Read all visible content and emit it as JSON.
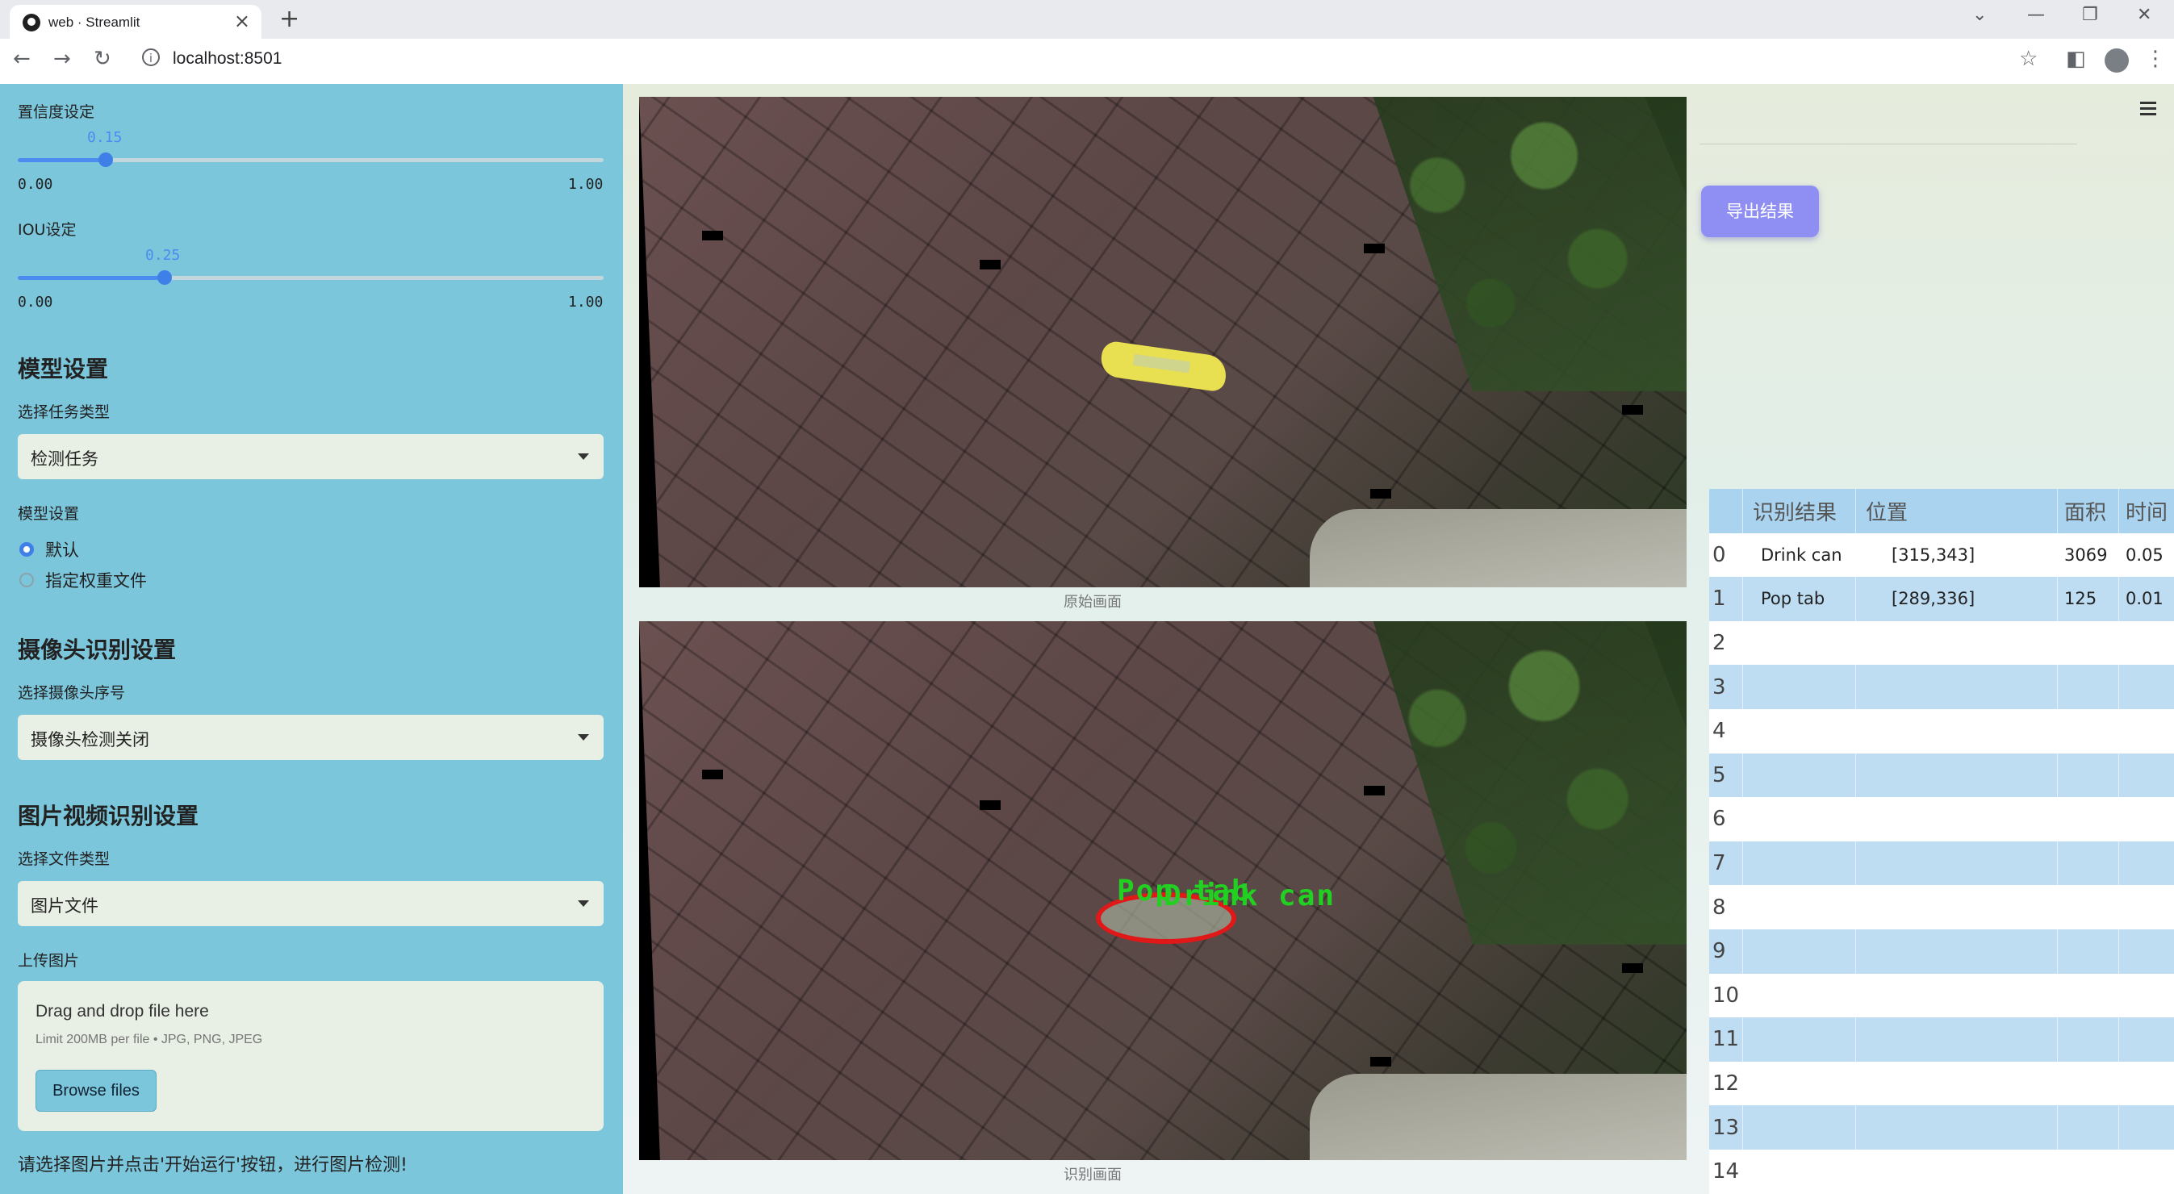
{
  "browser": {
    "tab_title": "web · Streamlit",
    "tab_close": "×",
    "new_tab": "+",
    "url": "localhost:8501",
    "controls": {
      "back": "←",
      "forward": "→",
      "reload": "↻",
      "info": "i",
      "star": "☆",
      "minimize": "—",
      "restore": "❐",
      "close": "✕",
      "chevron": "⌄",
      "side_panel": "◧",
      "menu": "⋮"
    }
  },
  "sidebar": {
    "confidence": {
      "label": "置信度设定",
      "value": "0.15",
      "min": "0.00",
      "max": "1.00",
      "fraction": 0.15
    },
    "iou": {
      "label": "IOU设定",
      "value": "0.25",
      "min": "0.00",
      "max": "1.00",
      "fraction": 0.25
    },
    "model_section": "模型设置",
    "task_type_label": "选择任务类型",
    "task_type_value": "检测任务",
    "model_settings_label": "模型设置",
    "model_options": [
      {
        "label": "默认",
        "selected": true
      },
      {
        "label": "指定权重文件",
        "selected": false
      }
    ],
    "camera_section": "摄像头识别设置",
    "camera_label": "选择摄像头序号",
    "camera_value": "摄像头检测关闭",
    "media_section": "图片视频识别设置",
    "file_type_label": "选择文件类型",
    "file_type_value": "图片文件",
    "upload_label": "上传图片",
    "uploader": {
      "title": "Drag and drop file here",
      "limit": "Limit 200MB per file • JPG, PNG, JPEG",
      "button": "Browse files"
    },
    "footer_text": "请选择图片并点击'开始运行'按钮，进行图片检测!"
  },
  "main": {
    "original_caption": "原始画面",
    "detected_caption": "识别画面",
    "detection_labels": [
      "Pop tab",
      "Drink can"
    ],
    "export_button": "导出结果",
    "table": {
      "columns": [
        "识别结果",
        "位置",
        "面积",
        "时间"
      ],
      "rows": [
        {
          "idx": "0",
          "result": "Drink can",
          "position": "[315,343]",
          "area": "3069",
          "time": "0.05"
        },
        {
          "idx": "1",
          "result": "Pop tab",
          "position": "[289,336]",
          "area": "125",
          "time": "0.01"
        },
        {
          "idx": "2",
          "result": "",
          "position": "",
          "area": "",
          "time": ""
        },
        {
          "idx": "3",
          "result": "",
          "position": "",
          "area": "",
          "time": ""
        },
        {
          "idx": "4",
          "result": "",
          "position": "",
          "area": "",
          "time": ""
        },
        {
          "idx": "5",
          "result": "",
          "position": "",
          "area": "",
          "time": ""
        },
        {
          "idx": "6",
          "result": "",
          "position": "",
          "area": "",
          "time": ""
        },
        {
          "idx": "7",
          "result": "",
          "position": "",
          "area": "",
          "time": ""
        },
        {
          "idx": "8",
          "result": "",
          "position": "",
          "area": "",
          "time": ""
        },
        {
          "idx": "9",
          "result": "",
          "position": "",
          "area": "",
          "time": ""
        },
        {
          "idx": "10",
          "result": "",
          "position": "",
          "area": "",
          "time": ""
        },
        {
          "idx": "11",
          "result": "",
          "position": "",
          "area": "",
          "time": ""
        },
        {
          "idx": "12",
          "result": "",
          "position": "",
          "area": "",
          "time": ""
        },
        {
          "idx": "13",
          "result": "",
          "position": "",
          "area": "",
          "time": ""
        },
        {
          "idx": "14",
          "result": "",
          "position": "",
          "area": "",
          "time": ""
        }
      ]
    }
  },
  "colors": {
    "sidebar_bg": "#7cc6dc",
    "accent": "#3f7fe8",
    "export_button": "#8f8ef3",
    "detect_box": "#e01818",
    "detect_label": "#22d022"
  }
}
